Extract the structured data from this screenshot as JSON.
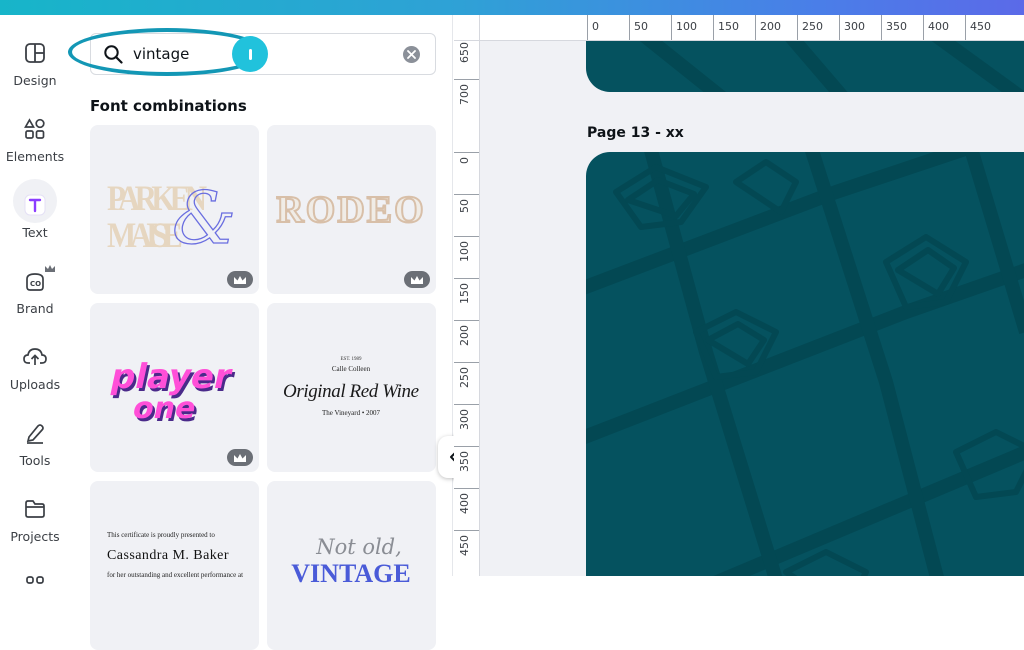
{
  "colors": {
    "accent": "#21c2dc",
    "page_teal": "#05525f",
    "text_purple": "#8b3dff"
  },
  "rail": {
    "items": [
      {
        "label": "Design",
        "icon": "layout-icon"
      },
      {
        "label": "Elements",
        "icon": "shapes-icon"
      },
      {
        "label": "Text",
        "icon": "text-t-icon",
        "active": true
      },
      {
        "label": "Brand",
        "icon": "brand-icon"
      },
      {
        "label": "Uploads",
        "icon": "cloud-upload-icon"
      },
      {
        "label": "Tools",
        "icon": "pen-tool-icon"
      },
      {
        "label": "Projects",
        "icon": "folder-icon"
      }
    ]
  },
  "search": {
    "value": "vintage",
    "placeholder": ""
  },
  "panel": {
    "section_title": "Font combinations",
    "cards": [
      {
        "lines": [
          "PARKEN",
          "MAISE"
        ],
        "glyph": "&",
        "pro": true
      },
      {
        "lines": [
          "RODEO"
        ],
        "pro": true
      },
      {
        "lines": [
          "player",
          "one"
        ],
        "pro": true
      },
      {
        "lines": [
          "EST. 1989",
          "Calle Colleen",
          "Original Red Wine",
          "The Vineyard • 2007"
        ],
        "pro": false
      },
      {
        "lines": [
          "This certificate is proudly presented to",
          "Cassandra M. Baker",
          "for her outstanding and excellent performance at"
        ],
        "pro": false
      },
      {
        "lines": [
          "Not old,",
          "VINTAGE"
        ],
        "pro": false
      }
    ]
  },
  "ruler": {
    "h": [
      "0",
      "50",
      "100",
      "150",
      "200",
      "250",
      "300",
      "350",
      "400",
      "450"
    ],
    "v_top": [
      "650",
      "700"
    ],
    "v_main": [
      "0",
      "50",
      "100",
      "150",
      "200",
      "250",
      "300",
      "350",
      "400",
      "450"
    ]
  },
  "canvas": {
    "page_label": "Page 13 - xx"
  }
}
